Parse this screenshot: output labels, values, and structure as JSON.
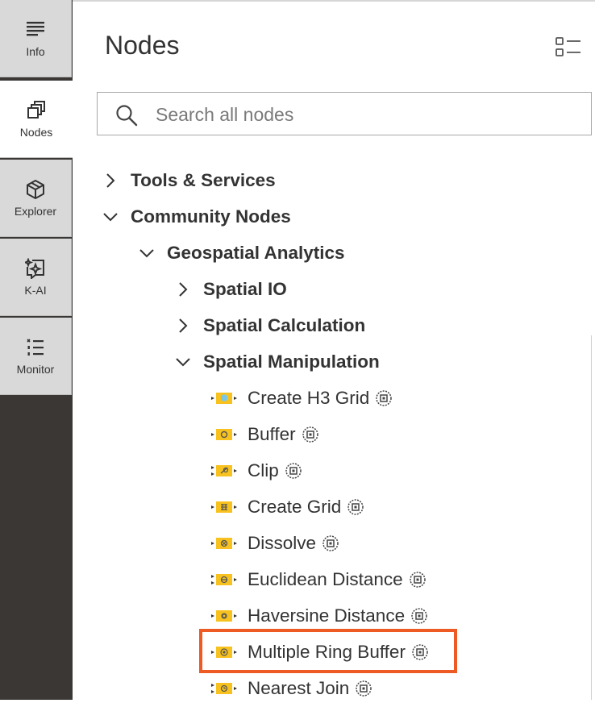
{
  "rail": {
    "items": [
      {
        "label": "Info",
        "icon": "info-lines-icon"
      },
      {
        "label": "Nodes",
        "icon": "nodes-icon",
        "active": true
      },
      {
        "label": "Explorer",
        "icon": "explorer-cube-icon"
      },
      {
        "label": "K-AI",
        "icon": "k-ai-sparkle-icon"
      },
      {
        "label": "Monitor",
        "icon": "monitor-list-icon"
      }
    ]
  },
  "panel": {
    "title": "Nodes",
    "menu_icon": "list-view-icon"
  },
  "search": {
    "placeholder": "Search all nodes",
    "value": ""
  },
  "tree": {
    "tools_services": "Tools & Services",
    "community_nodes": "Community Nodes",
    "geospatial_analytics": "Geospatial Analytics",
    "spatial_io": "Spatial IO",
    "spatial_calculation": "Spatial Calculation",
    "spatial_manipulation": "Spatial Manipulation",
    "nodes": [
      {
        "label": "Create H3 Grid",
        "icon": "h3-grid-node-icon"
      },
      {
        "label": "Buffer",
        "icon": "buffer-node-icon"
      },
      {
        "label": "Clip",
        "icon": "clip-node-icon"
      },
      {
        "label": "Create Grid",
        "icon": "grid-node-icon"
      },
      {
        "label": "Dissolve",
        "icon": "dissolve-node-icon"
      },
      {
        "label": "Euclidean Distance",
        "icon": "euclidean-node-icon"
      },
      {
        "label": "Haversine Distance",
        "icon": "haversine-node-icon"
      },
      {
        "label": "Multiple Ring Buffer",
        "icon": "ring-buffer-node-icon",
        "highlighted": true
      },
      {
        "label": "Nearest Join",
        "icon": "nearest-join-node-icon"
      }
    ]
  },
  "colors": {
    "rail_dark": "#3a3735",
    "rail_button": "#d9d9d9",
    "node_yellow": "#f7c21f",
    "highlight": "#ee5a24"
  }
}
